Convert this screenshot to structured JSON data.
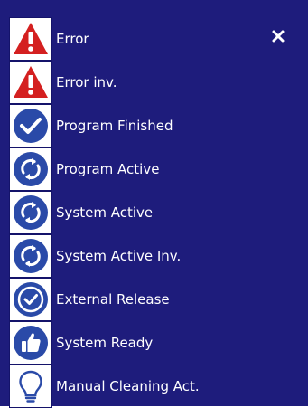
{
  "colors": {
    "panel_bg": "#1e1c7c",
    "icon_bg": "#ffffff",
    "error_red": "#d42020",
    "status_blue": "#2a4aa8",
    "text": "#ffffff"
  },
  "close": {
    "glyph": "✕"
  },
  "items": [
    {
      "label": "Error",
      "icon": "warning-triangle-icon"
    },
    {
      "label": "Error inv.",
      "icon": "warning-triangle-icon"
    },
    {
      "label": "Program Finished",
      "icon": "checkmark-circle-icon"
    },
    {
      "label": "Program Active",
      "icon": "rotate-arrows-icon"
    },
    {
      "label": "System Active",
      "icon": "rotate-arrows-icon"
    },
    {
      "label": "System Active Inv.",
      "icon": "rotate-arrows-icon"
    },
    {
      "label": "External Release",
      "icon": "check-ring-icon"
    },
    {
      "label": "System Ready",
      "icon": "thumbs-up-icon"
    },
    {
      "label": "Manual Cleaning Act.",
      "icon": "lightbulb-icon"
    }
  ]
}
